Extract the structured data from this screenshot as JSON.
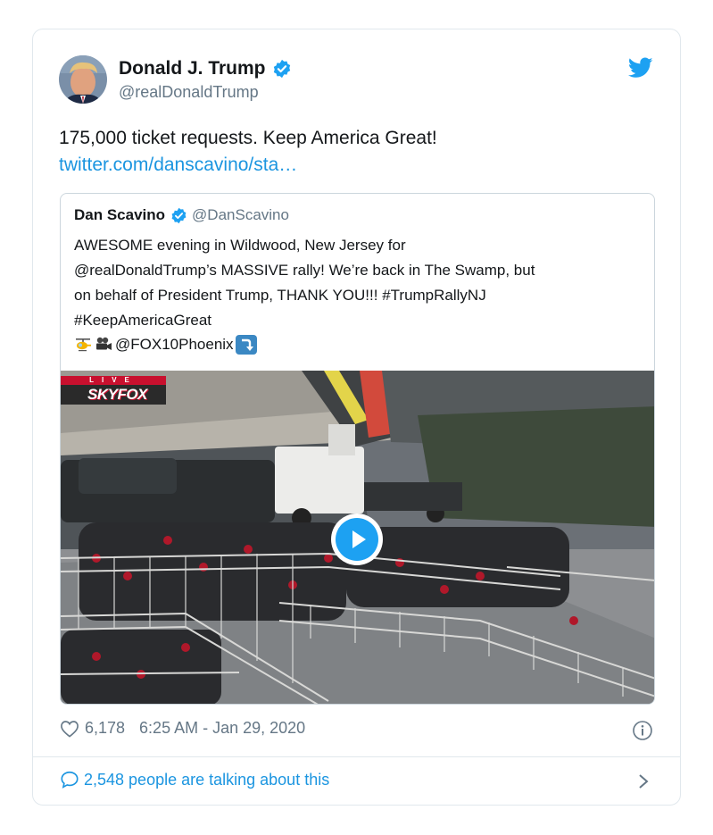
{
  "author": {
    "name": "Donald J. Trump",
    "handle": "@realDonaldTrump"
  },
  "tweet": {
    "text": "175,000 ticket requests. Keep America Great!",
    "link": "twitter.com/danscavino/sta…"
  },
  "quoted": {
    "name": "Dan Scavino",
    "handle": "@DanScavino",
    "text": "AWESOME evening in Wildwood, New Jersey for\n@realDonaldTrump’s MASSIVE rally! We’re back in The Swamp, but\non behalf of President Trump, THANK YOU!!! #TrumpRallyNJ\n#KeepAmericaGreat",
    "credit": "@FOX10Phoenix",
    "emojis": [
      "helicopter-icon",
      "movie-camera-icon",
      "right-arrow-curving-down-icon"
    ],
    "video": {
      "badge_top": "LIVE",
      "badge_brand": "SKYFOX"
    }
  },
  "footer": {
    "likes": "6,178",
    "timestamp": "6:25 AM - Jan 29, 2020",
    "talking": "2,548 people are talking about this"
  },
  "colors": {
    "accent": "#1da1f2",
    "link": "#1b95e0",
    "secondary_text": "#657786"
  }
}
